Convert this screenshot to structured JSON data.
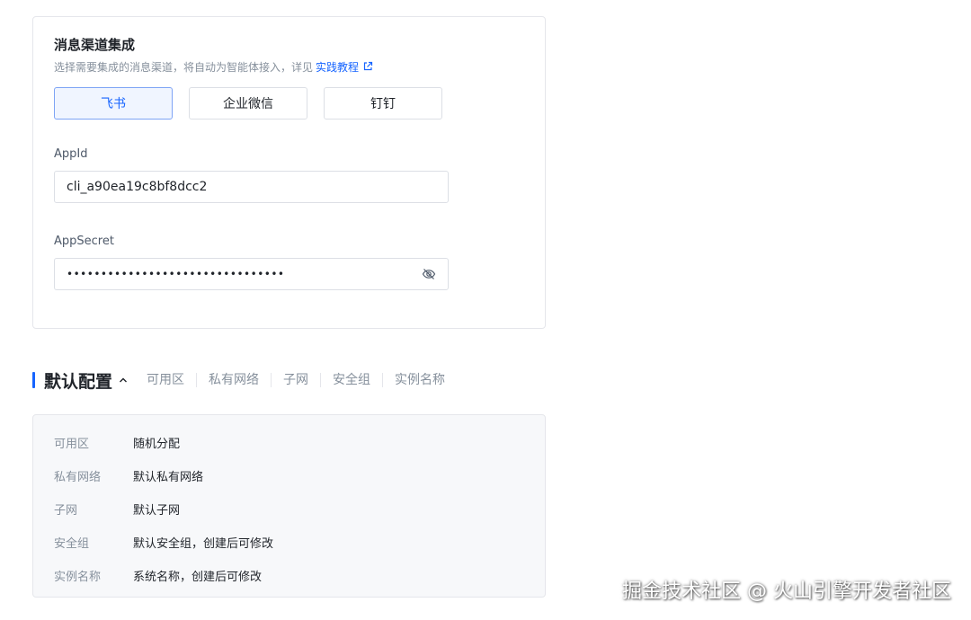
{
  "channel_card": {
    "title": "消息渠道集成",
    "description": "选择需要集成的消息渠道，将自动为智能体接入，详见",
    "link_label": "实践教程",
    "tabs": [
      {
        "label": "飞书",
        "active": true
      },
      {
        "label": "企业微信",
        "active": false
      },
      {
        "label": "钉钉",
        "active": false
      }
    ],
    "app_id": {
      "label": "AppId",
      "value": "cli_a90ea19c8bf8dcc2"
    },
    "app_secret": {
      "label": "AppSecret",
      "value": "••••••••••••••••••••••••••••••••"
    }
  },
  "default_config": {
    "title": "默认配置",
    "summary": [
      "可用区",
      "私有网络",
      "子网",
      "安全组",
      "实例名称"
    ],
    "rows": [
      {
        "key": "可用区",
        "value": "随机分配"
      },
      {
        "key": "私有网络",
        "value": "默认私有网络"
      },
      {
        "key": "子网",
        "value": "默认子网"
      },
      {
        "key": "安全组",
        "value": "默认安全组，创建后可修改"
      },
      {
        "key": "实例名称",
        "value": "系统名称，创建后可修改"
      }
    ]
  },
  "watermark": "掘金技术社区 @ 火山引擎开发者社区",
  "colors": {
    "accent": "#1664ff",
    "border": "#e5e6eb",
    "muted": "#86909c"
  },
  "icons": {
    "external_link": "external-link-icon",
    "eye": "eye-off-icon",
    "chevron": "chevron-up-icon"
  }
}
